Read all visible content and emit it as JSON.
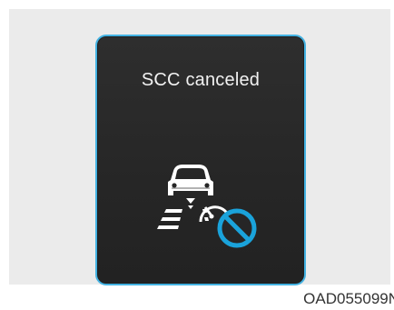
{
  "display": {
    "message": "SCC canceled",
    "icon": "scc-canceled-icon",
    "frame_color": "#43b2e2",
    "cancel_color": "#1aa3db"
  },
  "figure_code": "OAD055099N"
}
